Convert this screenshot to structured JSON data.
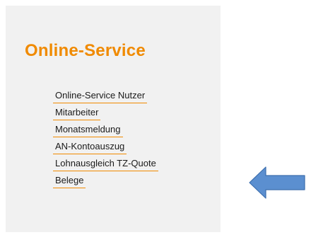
{
  "panel": {
    "title": "Online-Service",
    "menu_items": [
      {
        "label": "Online-Service Nutzer"
      },
      {
        "label": "Mitarbeiter"
      },
      {
        "label": "Monatsmeldung"
      },
      {
        "label": "AN-Kontoauszug"
      },
      {
        "label": "Lohnausgleich TZ-Quote"
      },
      {
        "label": "Belege"
      }
    ]
  },
  "annotation": {
    "arrow_icon": "left-arrow-icon",
    "arrow_color": "#5b8fd0",
    "arrow_border_color": "#3d6fae"
  },
  "colors": {
    "accent": "#f08a00",
    "panel_background": "#f1f1f1",
    "link_text": "#1a1a1a"
  }
}
